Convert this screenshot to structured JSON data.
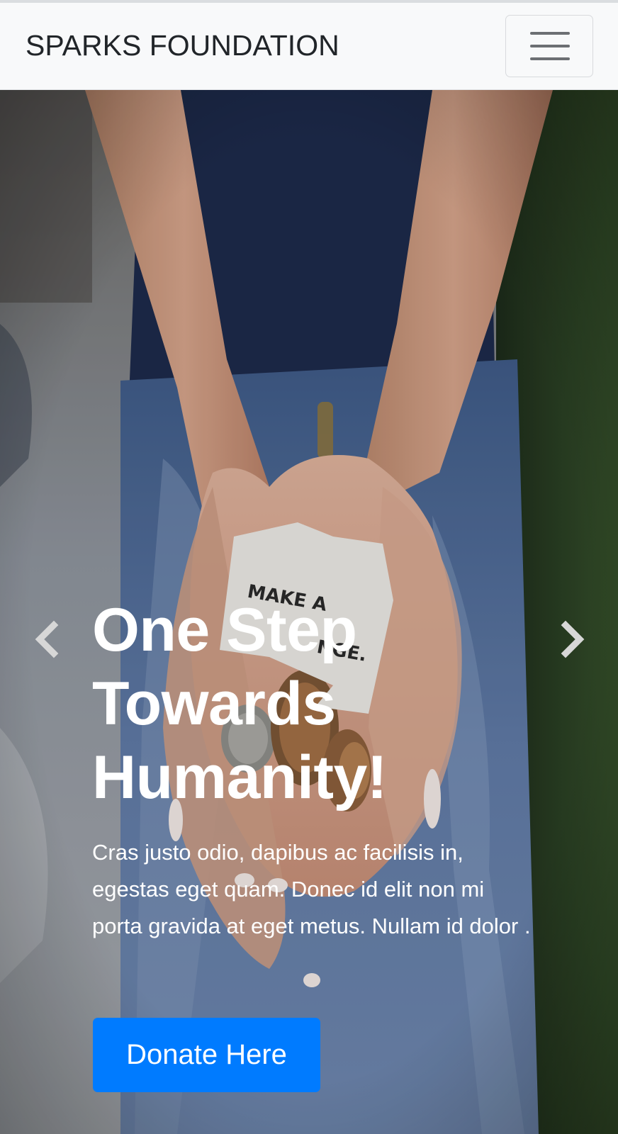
{
  "navbar": {
    "brand": "SPARKS FOUNDATION",
    "toggler_icon": "hamburger-menu-icon"
  },
  "hero": {
    "heading": "One Step Towards Humanity!",
    "text": "Cras justo odio, dapibus ac facilisis in, egestas eget quam. Donec id elit non mi porta gravida at eget metus. Nullam id dolor .",
    "button_label": "Donate Here",
    "prev_icon": "chevron-left-icon",
    "next_icon": "chevron-right-icon",
    "photo_note_text": "MAKE A CHANGE."
  },
  "colors": {
    "accent": "#007bff",
    "navbar_bg": "#f8f9fa",
    "brand_text": "#212529"
  }
}
